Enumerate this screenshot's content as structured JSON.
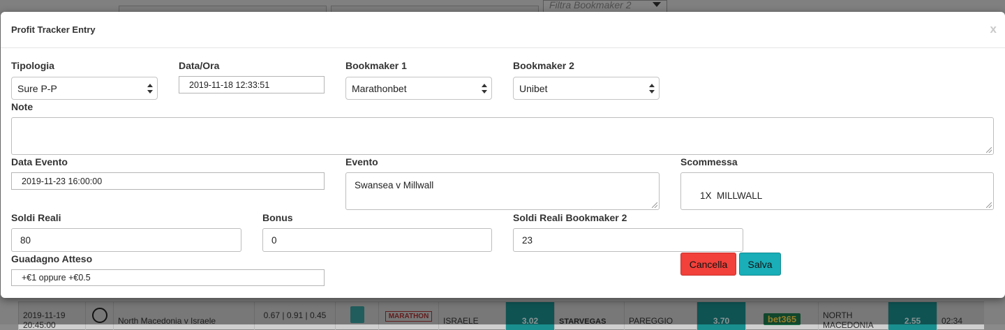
{
  "background": {
    "filter_placeholder": "Filtra Bookmaker 2",
    "row": {
      "date": "2019-11-19 20:45:00",
      "event": "North Macedonia v Israele",
      "ratios": "0.67 | 0.91 | 0.45",
      "logo1": "MARATHON",
      "bet1": "ISRAELE",
      "odd1": "3.02",
      "logo2": "STARVEGAS",
      "bet2": "PAREGGIO",
      "odd2": "3.70",
      "logo3": "bet365",
      "bet3": "NORTH MACEDONIA",
      "odd3": "2.55",
      "time_left": "02:34"
    }
  },
  "modal": {
    "title": "Profit Tracker Entry",
    "close": "x",
    "tipologia": {
      "label": "Tipologia",
      "value": "Sure P-P"
    },
    "data_ora": {
      "label": "Data/Ora",
      "value": "2019-11-18 12:33:51"
    },
    "bookmaker1": {
      "label": "Bookmaker 1",
      "value": "Marathonbet"
    },
    "bookmaker2": {
      "label": "Bookmaker 2",
      "value": "Unibet"
    },
    "note": {
      "label": "Note",
      "value": ""
    },
    "data_evento": {
      "label": "Data Evento",
      "value": "2019-11-23 16:00:00"
    },
    "evento": {
      "label": "Evento",
      "value": "Swansea v Millwall"
    },
    "scommessa": {
      "label": "Scommessa",
      "value": "1X  MILLWALL"
    },
    "soldi_reali": {
      "label": "Soldi Reali",
      "value": "80"
    },
    "bonus": {
      "label": "Bonus",
      "value": "0"
    },
    "soldi_reali_b2": {
      "label": "Soldi Reali Bookmaker 2",
      "value": "23"
    },
    "guadagno": {
      "label": "Guadagno Atteso",
      "value": "+€1 oppure +€0.5"
    },
    "cancel_label": "Cancella",
    "save_label": "Salva"
  }
}
